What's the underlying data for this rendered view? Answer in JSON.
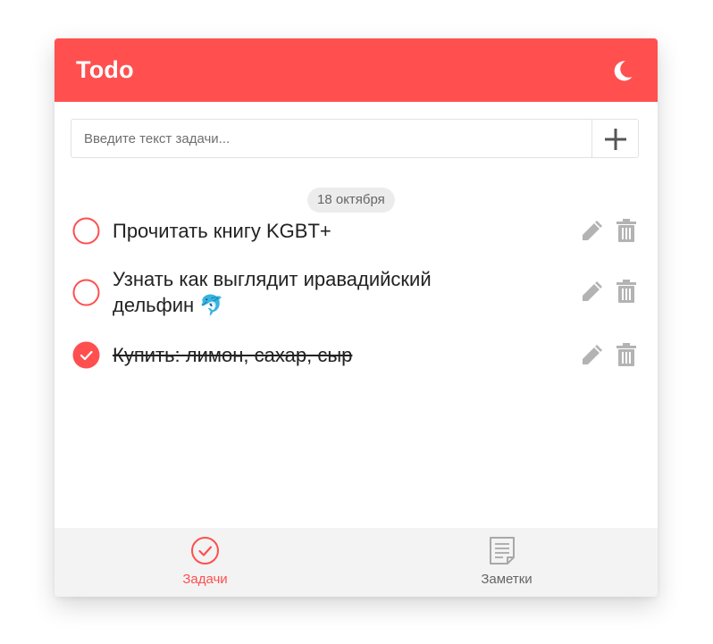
{
  "app": {
    "title": "Todo",
    "theme_icon": "moon-icon"
  },
  "new_task": {
    "placeholder": "Введите текст задачи...",
    "value": "",
    "add_icon": "plus-icon"
  },
  "date_group": {
    "label": "18 октября"
  },
  "tasks": [
    {
      "text": "Прочитать книгу KGBT+",
      "completed": false,
      "edit_icon": "pencil-icon",
      "delete_icon": "trash-icon"
    },
    {
      "text": "Узнать как выглядит иравадийский дельфин 🐬",
      "completed": false,
      "edit_icon": "pencil-icon",
      "delete_icon": "trash-icon"
    },
    {
      "text": "Купить: лимон, сахар, сыр",
      "completed": true,
      "edit_icon": "pencil-icon",
      "delete_icon": "trash-icon"
    }
  ],
  "nav": {
    "tasks_label": "Задачи",
    "notes_label": "Заметки",
    "active": "tasks"
  },
  "colors": {
    "accent": "#ff4f4f",
    "icon_gray": "#b3b3b3",
    "nav_background": "#f3f3f3"
  }
}
